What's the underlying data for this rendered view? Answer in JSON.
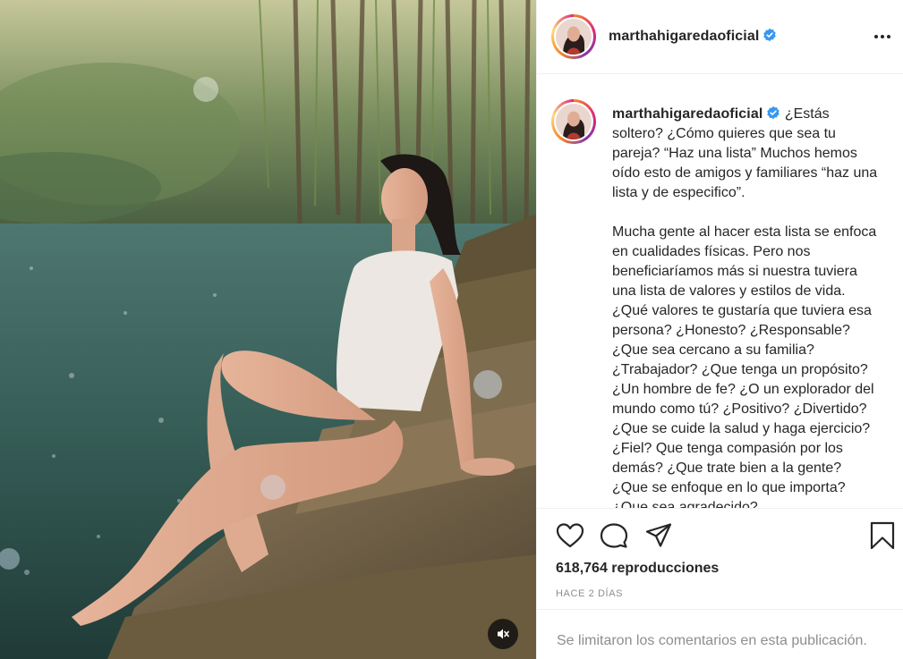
{
  "post": {
    "username": "marthahigaredaoficial",
    "caption_paragraphs": [
      "¿Estás soltero? ¿Cómo quieres que sea tu pareja? “Haz una lista” Muchos hemos oído esto de amigos y familiares “haz una lista y de especifico”.",
      "Mucha gente al hacer esta lista se enfoca en cualidades físicas. Pero nos beneficiaríamos más si nuestra tuviera una lista de valores y estilos de vida. ¿Qué valores te gustaría que tuviera esa persona? ¿Honesto? ¿Responsable? ¿Que sea cercano a su familia? ¿Trabajador? ¿Que tenga un propósito? ¿Un hombre de fe? ¿O un explorador del mundo como tú? ¿Positivo? ¿Divertido? ¿Que se cuide la salud y haga ejercicio? ¿Fiel? Que tenga compasión por los demás? ¿Que trate bien a la gente? ¿Que se enfoque en lo que importa? ¿Que sea agradecido?"
    ],
    "views": "618,764 reproducciones",
    "time_ago": "HACE 2 DÍAS",
    "comments_limited": "Se limitaron los comentarios en esta publicación."
  },
  "icons": {
    "verified": "verified-badge-icon",
    "more": "more-options-icon",
    "like": "heart-icon",
    "comment": "comment-icon",
    "share": "share-icon",
    "save": "bookmark-icon",
    "mute": "speaker-muted-icon"
  },
  "colors": {
    "verified_blue": "#3897f0",
    "text": "#262626",
    "secondary_text": "#8e8e8e",
    "divider": "#efefef"
  }
}
